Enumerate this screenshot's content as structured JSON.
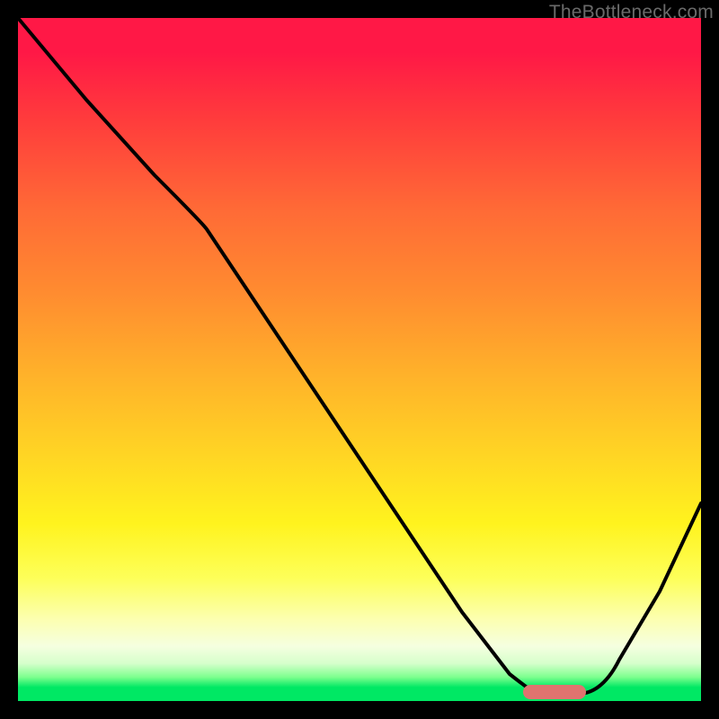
{
  "watermark": "TheBottleneck.com",
  "colors": {
    "curve": "#000000",
    "marker": "#e0736f",
    "gradient_top": "#ff1846",
    "gradient_bottom": "#00e864",
    "background": "#000000"
  },
  "chart_data": {
    "type": "line",
    "title": "",
    "xlabel": "",
    "ylabel": "",
    "xlim": [
      0,
      100
    ],
    "ylim": [
      0,
      100
    ],
    "grid": false,
    "background": "vertical-gradient-red-to-green",
    "series": [
      {
        "name": "bottleneck-curve",
        "x": [
          0,
          10,
          20,
          27,
          35,
          45,
          55,
          65,
          72,
          76,
          82,
          88,
          94,
          100
        ],
        "y": [
          100,
          88,
          77,
          70,
          58,
          43,
          28,
          13,
          4,
          1,
          1,
          6,
          16,
          29
        ]
      }
    ],
    "annotations": [
      {
        "name": "optimal-range-marker",
        "type": "bar",
        "x_start": 74,
        "x_end": 83,
        "y": 1,
        "color": "#e0736f"
      }
    ]
  }
}
